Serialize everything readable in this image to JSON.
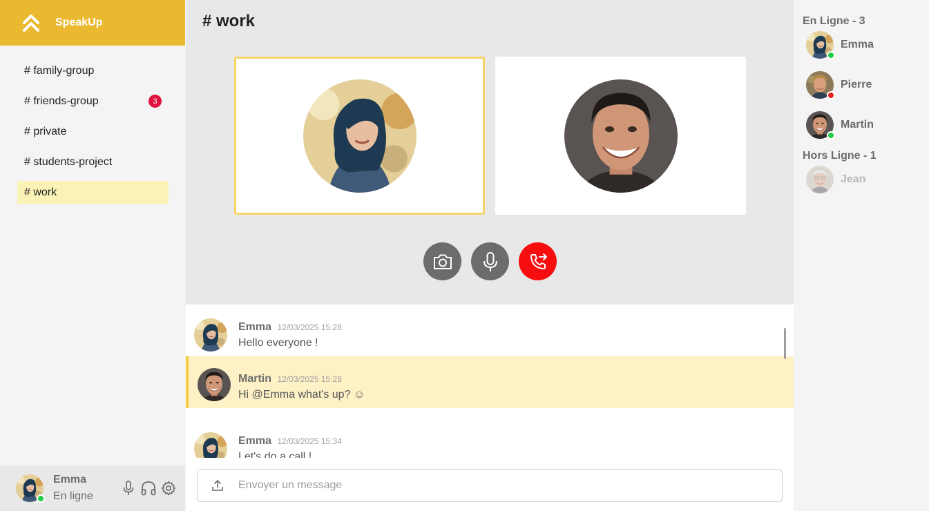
{
  "app": {
    "name": "SpeakUp"
  },
  "channels": [
    {
      "label": "# family-group",
      "badge": ""
    },
    {
      "label": "# friends-group",
      "badge": "3"
    },
    {
      "label": "# private",
      "badge": ""
    },
    {
      "label": "# students-project",
      "badge": ""
    },
    {
      "label": "# work",
      "badge": ""
    }
  ],
  "current_user": {
    "name": "Emma",
    "status": "En ligne"
  },
  "main": {
    "channel_title": "# work"
  },
  "messages": [
    {
      "author": "Emma",
      "time": "12/03/2025 15:28",
      "text": "Hello everyone !"
    },
    {
      "author": "Martin",
      "time": "12/03/2025 15:28",
      "text": "Hi @Emma what's up? ☺"
    },
    {
      "author": "Emma",
      "time": "12/03/2025 15:34",
      "text": "Let's do a call !"
    }
  ],
  "composer": {
    "placeholder": "Envoyer un message"
  },
  "members": {
    "online_title": "En Ligne - 3",
    "offline_title": "Hors Ligne - 1",
    "online": [
      {
        "name": "Emma",
        "status": "online"
      },
      {
        "name": "Pierre",
        "status": "busy"
      },
      {
        "name": "Martin",
        "status": "online"
      }
    ],
    "offline": [
      {
        "name": "Jean"
      }
    ]
  },
  "colors": {
    "brand": "#ebb930",
    "active_channel": "#fbf2b6",
    "badge": "#e0133f",
    "hangup": "#f60d0d",
    "control": "#6c6c6c",
    "highlight_message": "#fef1c6",
    "online": "#22cc44",
    "busy": "#e52222"
  },
  "icons": {
    "brand": "double-chevron-up-icon",
    "camera": "camera-icon",
    "mic": "microphone-icon",
    "hangup": "phone-leave-icon",
    "headphones": "headphones-icon",
    "settings": "gear-icon",
    "upload": "upload-icon"
  }
}
